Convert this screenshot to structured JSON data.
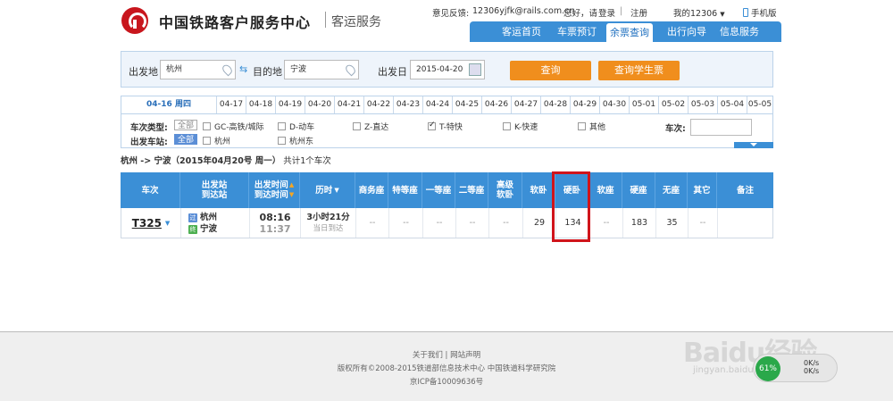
{
  "header": {
    "logo_title": "中国铁路客户服务中心",
    "logo_sub": "客运服务",
    "feedback_label": "意见反馈:",
    "feedback_email": "12306yjfk@rails.com.cn",
    "greeting": "您好，请",
    "login": "登录",
    "divider": "|",
    "register": "注册",
    "my12306": "我的12306",
    "mobile": "手机版"
  },
  "nav": {
    "items": [
      "客运首页",
      "车票预订",
      "余票查询",
      "出行向导",
      "信息服务"
    ],
    "active_index": 2
  },
  "search": {
    "from_label": "出发地",
    "from_value": "杭州",
    "to_label": "目的地",
    "to_value": "宁波",
    "date_label": "出发日",
    "date_value": "2015-04-20",
    "query_button": "查询",
    "student_button": "查询学生票"
  },
  "dates": [
    "04-16 周四",
    "04-17",
    "04-18",
    "04-19",
    "04-20",
    "04-21",
    "04-22",
    "04-23",
    "04-24",
    "04-25",
    "04-26",
    "04-27",
    "04-28",
    "04-29",
    "04-30",
    "05-01",
    "05-02",
    "05-03",
    "05-04",
    "05-05"
  ],
  "filters": {
    "type_label": "车次类型:",
    "all_label": "全部",
    "types": [
      {
        "label": "GC-高铁/城际",
        "checked": false
      },
      {
        "label": "D-动车",
        "checked": false
      },
      {
        "label": "Z-直达",
        "checked": false
      },
      {
        "label": "T-特快",
        "checked": true
      },
      {
        "label": "K-快速",
        "checked": false
      },
      {
        "label": "其他",
        "checked": false
      }
    ],
    "station_label": "出发车站:",
    "stations": [
      "杭州",
      "杭州东"
    ],
    "train_no_label": "车次:"
  },
  "route_summary": {
    "route": "杭州 -> 宁波（2015年04月20号  周一）",
    "count": "共计1个车次"
  },
  "table": {
    "headers": {
      "train": "车次",
      "station": "出发站\n到达站",
      "time": "出发时间\n到达时间",
      "duration": "历时",
      "business": "商务座",
      "special": "特等座",
      "first": "一等座",
      "second": "二等座",
      "adv_soft": "高级\n软卧",
      "soft_sleeper": "软卧",
      "hard_sleeper": "硬卧",
      "soft_seat": "软座",
      "hard_seat": "硬座",
      "no_seat": "无座",
      "other": "其它",
      "remark": "备注"
    },
    "rows": [
      {
        "train": "T325",
        "from_badge": "过",
        "from": "杭州",
        "to_badge": "终",
        "to": "宁波",
        "depart": "08:16",
        "arrive": "11:37",
        "duration": "3小时21分",
        "arrive_day": "当日到达",
        "business": "--",
        "special": "--",
        "first": "--",
        "second": "--",
        "adv_soft": "--",
        "soft_sleeper": "29",
        "hard_sleeper": "134",
        "soft_seat": "--",
        "hard_seat": "183",
        "no_seat": "35",
        "other": "--",
        "remark": ""
      }
    ]
  },
  "footer": {
    "links": "关于我们  |  网站声明",
    "copyright": "版权所有©2008-2015铁道部信息技术中心   中国铁道科学研究院",
    "icp": "京ICP备10009636号"
  },
  "watermark": {
    "brand": "Baidu经验",
    "url": "jingyan.baidu.com"
  },
  "speed_widget": {
    "percent": "61%",
    "rate": "0K/s",
    "rate2": "0K/s"
  },
  "colors": {
    "accent": "#3b8fd6",
    "orange": "#f08e1d",
    "highlight": "#d0141b"
  }
}
